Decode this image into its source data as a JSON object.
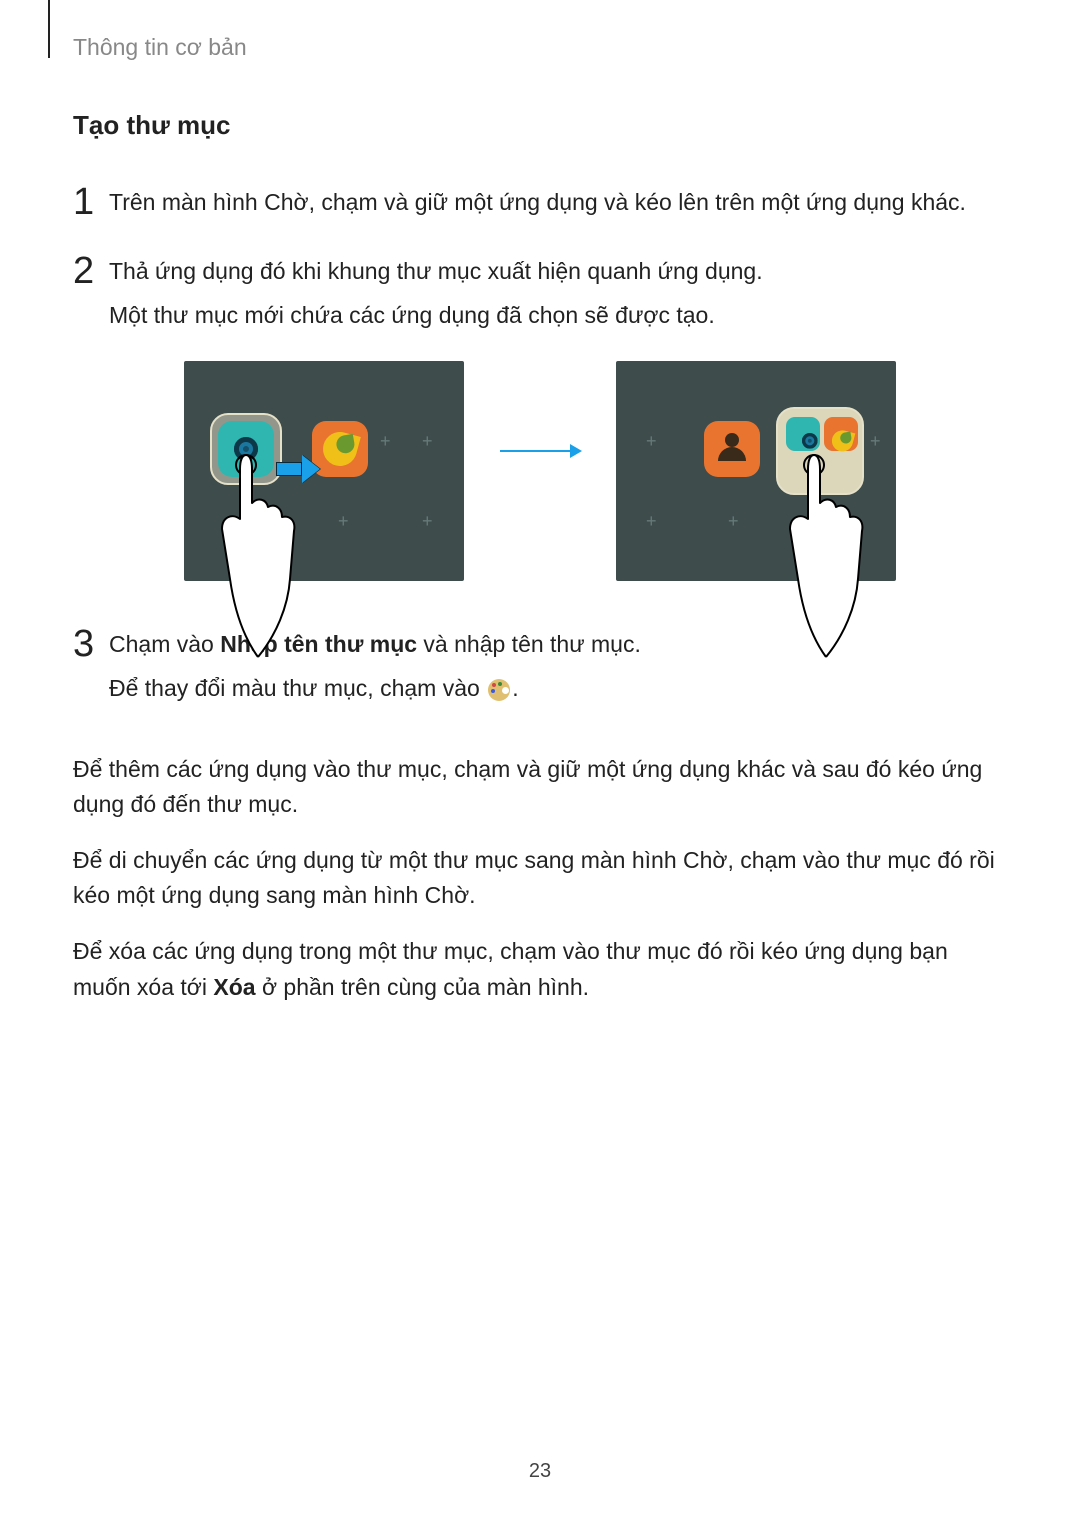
{
  "breadcrumb": "Thông tin cơ bản",
  "section_title": "Tạo thư mục",
  "step1": {
    "num": "1",
    "text": "Trên màn hình Chờ, chạm và giữ một ứng dụng và kéo lên trên một ứng dụng khác."
  },
  "step2": {
    "num": "2",
    "text": "Thả ứng dụng đó khi khung thư mục xuất hiện quanh ứng dụng.",
    "sub": "Một thư mục mới chứa các ứng dụng đã chọn sẽ được tạo."
  },
  "step3": {
    "num": "3",
    "pre": "Chạm vào ",
    "bold": "Nhập tên thư mục",
    "post": " và nhập tên thư mục.",
    "sub_pre": "Để thay đổi màu thư mục, chạm vào ",
    "sub_post": "."
  },
  "para_add": "Để thêm các ứng dụng vào thư mục, chạm và giữ một ứng dụng khác và sau đó kéo ứng dụng đó đến thư mục.",
  "para_move": "Để di chuyển các ứng dụng từ một thư mục sang màn hình Chờ, chạm vào thư mục đó rồi kéo một ứng dụng sang màn hình Chờ.",
  "para_del_pre": "Để xóa các ứng dụng trong một thư mục, chạm vào thư mục đó rồi kéo ứng dụng bạn muốn xóa tới ",
  "para_del_bold": "Xóa",
  "para_del_post": " ở phần trên cùng của màn hình.",
  "page_number": "23"
}
